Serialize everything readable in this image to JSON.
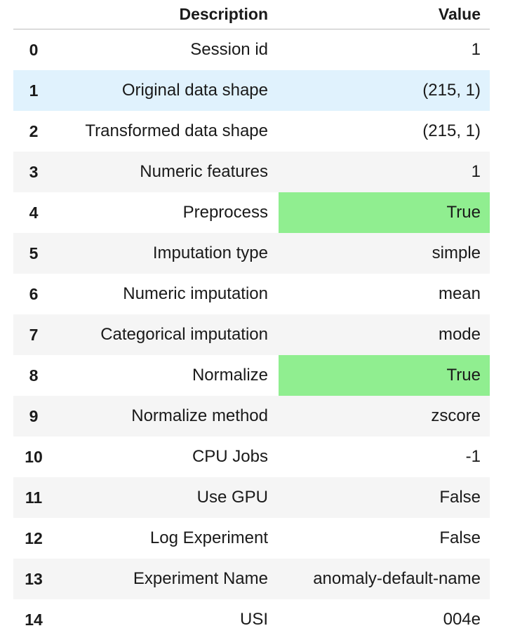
{
  "header": {
    "index_label": "",
    "description_label": "Description",
    "value_label": "Value"
  },
  "rows": [
    {
      "index": "0",
      "description": "Session id",
      "value": "1",
      "highlight": false
    },
    {
      "index": "1",
      "description": "Original data shape",
      "value": "(215, 1)",
      "highlight": false
    },
    {
      "index": "2",
      "description": "Transformed data shape",
      "value": "(215, 1)",
      "highlight": false
    },
    {
      "index": "3",
      "description": "Numeric features",
      "value": "1",
      "highlight": false
    },
    {
      "index": "4",
      "description": "Preprocess",
      "value": "True",
      "highlight": true
    },
    {
      "index": "5",
      "description": "Imputation type",
      "value": "simple",
      "highlight": false
    },
    {
      "index": "6",
      "description": "Numeric imputation",
      "value": "mean",
      "highlight": false
    },
    {
      "index": "7",
      "description": "Categorical imputation",
      "value": "mode",
      "highlight": false
    },
    {
      "index": "8",
      "description": "Normalize",
      "value": "True",
      "highlight": true
    },
    {
      "index": "9",
      "description": "Normalize method",
      "value": "zscore",
      "highlight": false
    },
    {
      "index": "10",
      "description": "CPU Jobs",
      "value": "-1",
      "highlight": false
    },
    {
      "index": "11",
      "description": "Use GPU",
      "value": "False",
      "highlight": false
    },
    {
      "index": "12",
      "description": "Log Experiment",
      "value": "False",
      "highlight": false
    },
    {
      "index": "13",
      "description": "Experiment Name",
      "value": "anomaly-default-name",
      "highlight": false
    },
    {
      "index": "14",
      "description": "USI",
      "value": "004e",
      "highlight": false
    }
  ],
  "colors": {
    "highlight": "#90ee90",
    "hover_row": "#e0f2fd",
    "alt_row": "#f5f5f5"
  },
  "hovered_row_index": 1
}
